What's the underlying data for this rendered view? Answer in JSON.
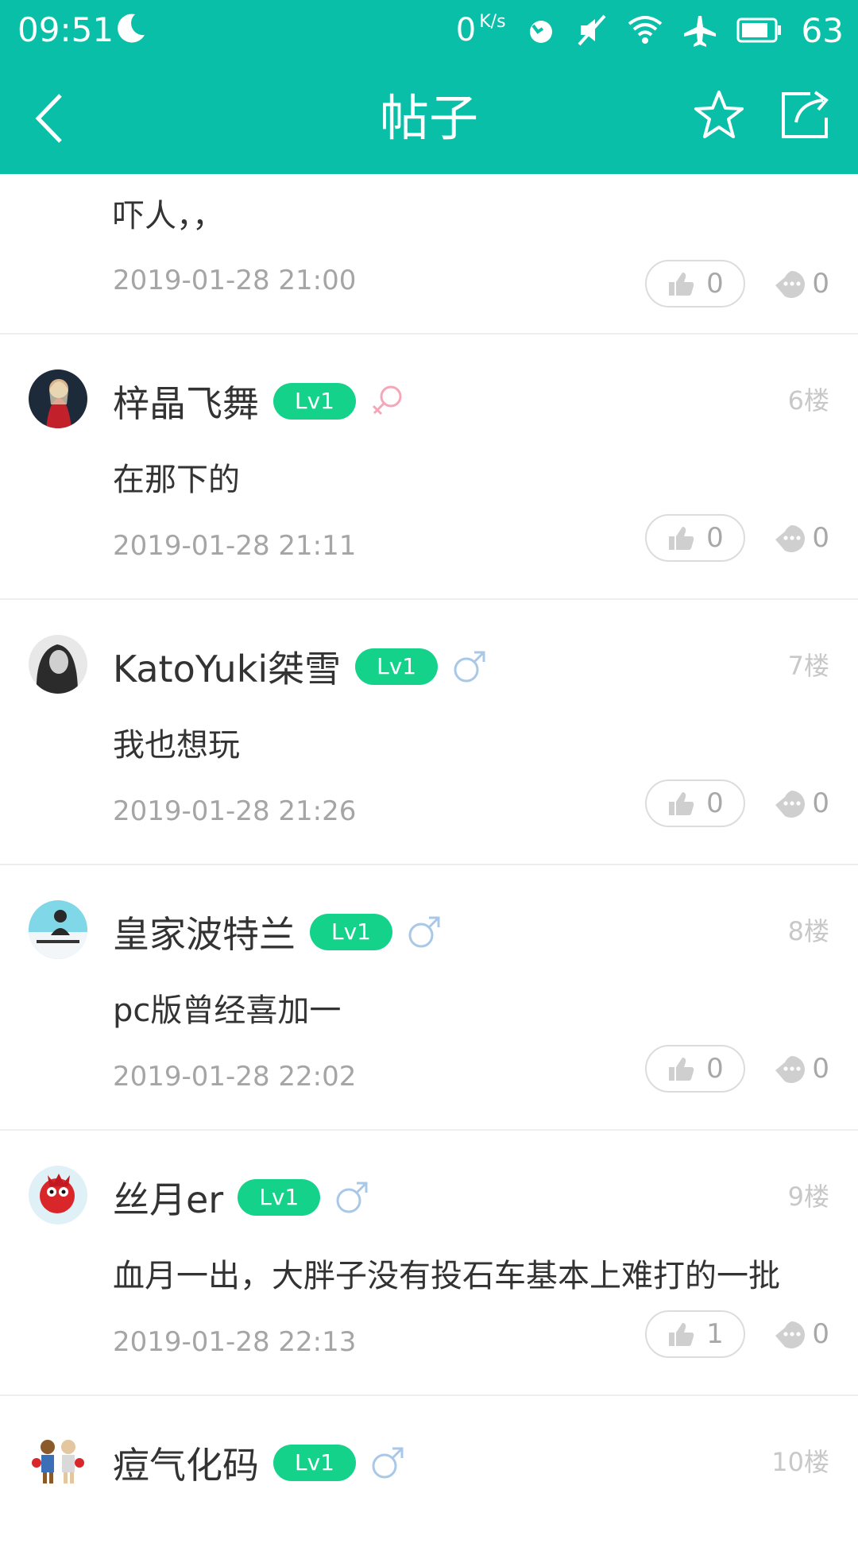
{
  "status_bar": {
    "time": "09:51",
    "speed": "0",
    "speed_unit": "K/s",
    "battery": "63"
  },
  "header": {
    "title": "帖子"
  },
  "colors": {
    "primary": "#09bfa8",
    "level_badge": "#15d28b",
    "female": "#f4a7b9",
    "male": "#a9c8e8"
  },
  "posts": [
    {
      "content": "吓人，，",
      "time": "2019-01-28 21:00",
      "likes": "0",
      "comments": "0"
    },
    {
      "username": "梓晶飞舞",
      "level": "Lv1",
      "gender": "female",
      "floor": "6楼",
      "content": "在那下的",
      "time": "2019-01-28 21:11",
      "likes": "0",
      "comments": "0"
    },
    {
      "username": "KatoYuki桀雪",
      "level": "Lv1",
      "gender": "male",
      "floor": "7楼",
      "content": "我也想玩",
      "time": "2019-01-28 21:26",
      "likes": "0",
      "comments": "0"
    },
    {
      "username": "皇家波特兰",
      "level": "Lv1",
      "gender": "male",
      "floor": "8楼",
      "content": "pc版曾经喜加一",
      "time": "2019-01-28 22:02",
      "likes": "0",
      "comments": "0"
    },
    {
      "username": "丝月er",
      "level": "Lv1",
      "gender": "male",
      "floor": "9楼",
      "content": "血月一出，大胖子没有投石车基本上难打的一批",
      "time": "2019-01-28 22:13",
      "likes": "1",
      "comments": "0"
    },
    {
      "username": "痘气化码",
      "level": "Lv1",
      "gender": "male",
      "floor": "10楼",
      "content": ""
    }
  ]
}
